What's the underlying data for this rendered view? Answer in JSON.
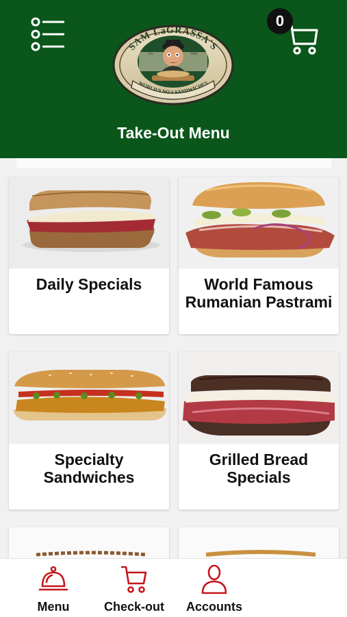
{
  "header": {
    "title": "Take-Out Menu",
    "menu_icon": "hamburger-list-icon",
    "cart_count": "0",
    "cart_icon": "shopping-cart-icon",
    "logo": {
      "arc_text": "SAM LaGRASSA'S",
      "banner_text": "WORLD'S NO.1 SANDWICHES",
      "est": "Est.",
      "year": "1968"
    },
    "background_color": "#0a561b"
  },
  "menu": {
    "categories": [
      {
        "title_line1": "Daily Specials",
        "title_line2": ""
      },
      {
        "title_line1": "World Famous",
        "title_line2": "Rumanian Pastrami"
      },
      {
        "title_line1": "Specialty",
        "title_line2": "Sandwiches"
      },
      {
        "title_line1": "Grilled Bread",
        "title_line2": "Specials"
      }
    ]
  },
  "bottom_nav": {
    "items": [
      {
        "label": "Menu",
        "icon": "service-bell-icon"
      },
      {
        "label": "Check-out",
        "icon": "shopping-cart-icon"
      },
      {
        "label": "Accounts",
        "icon": "person-icon"
      }
    ],
    "accent_color": "#c4161c"
  }
}
